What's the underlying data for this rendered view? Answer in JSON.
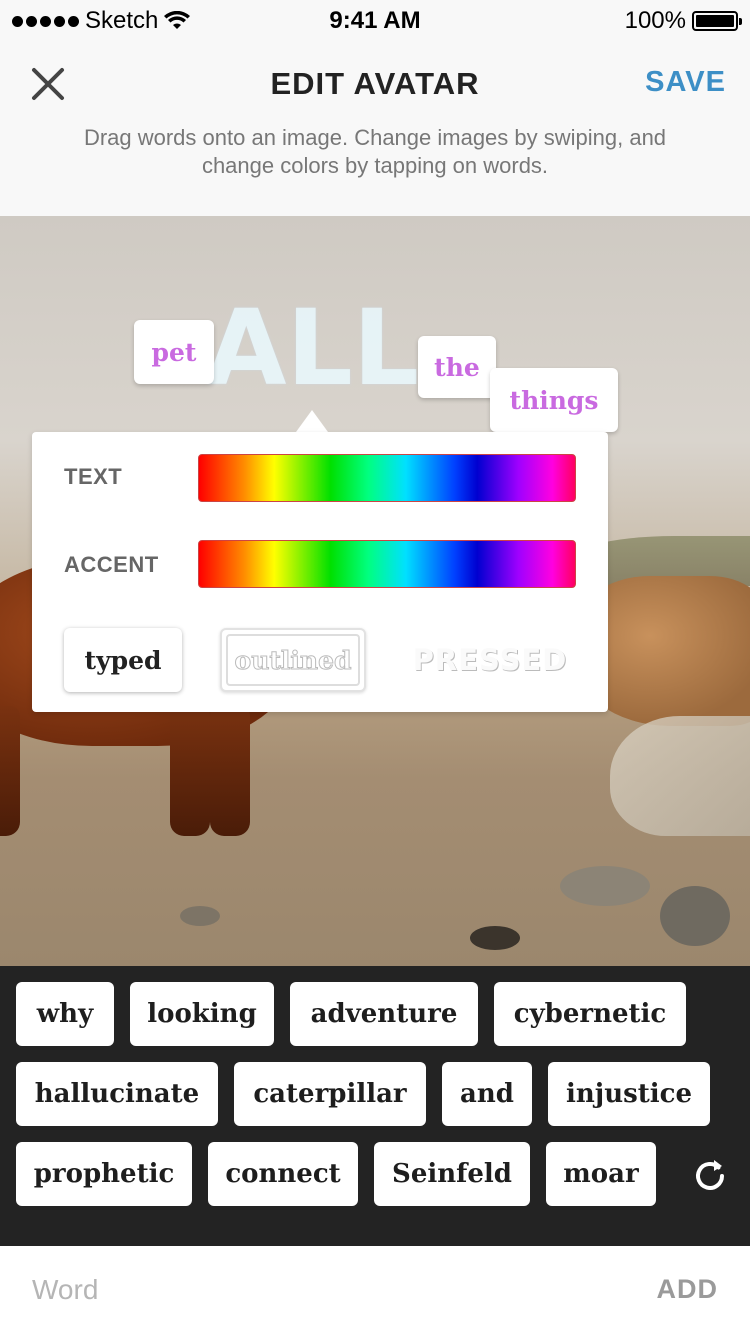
{
  "status_bar": {
    "carrier": "Sketch",
    "time": "9:41 AM",
    "battery": "100%"
  },
  "header": {
    "title": "EDIT AVATAR",
    "save_label": "SAVE",
    "subtitle": "Drag words onto an image. Change images by swiping, and change colors by tapping on words."
  },
  "canvas_words": {
    "pet": "pet",
    "all": "ALL",
    "the": "the",
    "things": "things"
  },
  "color_picker": {
    "text_label": "TEXT",
    "accent_label": "ACCENT",
    "styles": {
      "typed": "typed",
      "outlined": "outlined",
      "pressed": "PRESSED"
    }
  },
  "word_bank": {
    "words": [
      "why",
      "looking",
      "adventure",
      "cybernetic",
      "hallucinate",
      "caterpillar",
      "and",
      "injustice",
      "prophetic",
      "connect",
      "Seinfeld",
      "moar"
    ]
  },
  "input": {
    "placeholder": "Word",
    "add_label": "ADD"
  },
  "colors": {
    "accent_blue": "#3d8fc6",
    "word_pink": "#c96ae0",
    "bank_background": "#232323"
  }
}
